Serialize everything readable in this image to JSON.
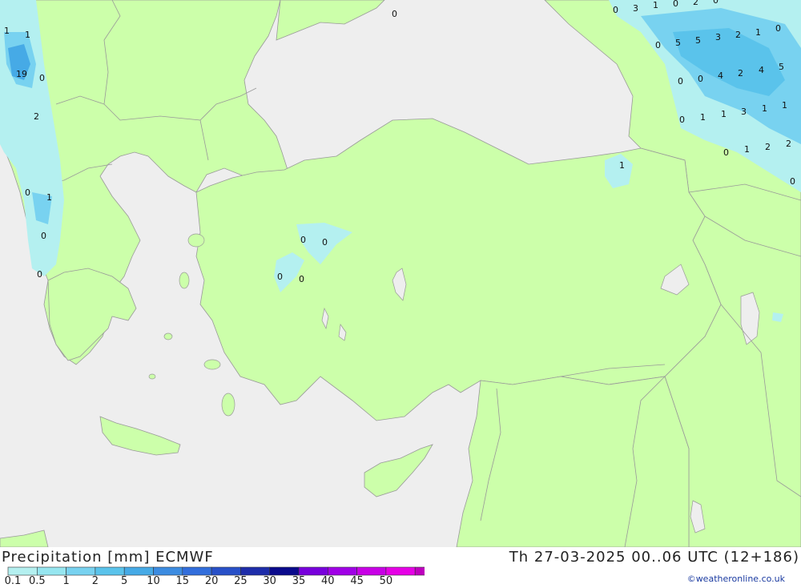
{
  "map": {
    "seas": "#eeeeee",
    "land": "#ccffaa",
    "border": "#999999",
    "city_mark": "0"
  },
  "footer": {
    "title": "Precipitation [mm] ECMWF",
    "datetime": "Th 27-03-2025 00..06 UTC (12+186)",
    "credit": "©weatheronline.co.uk"
  },
  "legend": {
    "ticks": [
      "0.1",
      "0.5",
      "1",
      "2",
      "5",
      "10",
      "15",
      "20",
      "25",
      "30",
      "35",
      "40",
      "45",
      "50"
    ],
    "colors": [
      "#b4f0f0",
      "#96e6f0",
      "#78d2f0",
      "#5ac3eb",
      "#46aae6",
      "#3c8ce1",
      "#326edc",
      "#2850c8",
      "#1e2daa",
      "#0a0a8c",
      "#7800dc",
      "#a000e6",
      "#c800e6",
      "#e600e6",
      "#be00be"
    ]
  },
  "precip_labels": [
    {
      "id": "a1",
      "text": "0"
    },
    {
      "id": "a2",
      "text": "3"
    },
    {
      "id": "a3",
      "text": "1"
    },
    {
      "id": "a4",
      "text": "0"
    },
    {
      "id": "a5",
      "text": "2"
    },
    {
      "id": "a6",
      "text": "0"
    },
    {
      "id": "b1",
      "text": "0"
    },
    {
      "id": "b2",
      "text": "5"
    },
    {
      "id": "b3",
      "text": "5"
    },
    {
      "id": "b4",
      "text": "3"
    },
    {
      "id": "b5",
      "text": "2"
    },
    {
      "id": "b6",
      "text": "1"
    },
    {
      "id": "b7",
      "text": "0"
    },
    {
      "id": "c1",
      "text": "0"
    },
    {
      "id": "c2",
      "text": "0"
    },
    {
      "id": "c3",
      "text": "4"
    },
    {
      "id": "c4",
      "text": "2"
    },
    {
      "id": "c5",
      "text": "4"
    },
    {
      "id": "c6",
      "text": "5"
    },
    {
      "id": "d1",
      "text": "0"
    },
    {
      "id": "d2",
      "text": "1"
    },
    {
      "id": "d3",
      "text": "1"
    },
    {
      "id": "d4",
      "text": "3"
    },
    {
      "id": "d5",
      "text": "1"
    },
    {
      "id": "d6",
      "text": "1"
    },
    {
      "id": "e1",
      "text": "0"
    },
    {
      "id": "e2",
      "text": "1"
    },
    {
      "id": "e3",
      "text": "2"
    },
    {
      "id": "e4",
      "text": "2"
    },
    {
      "id": "e5",
      "text": "0"
    },
    {
      "id": "f1",
      "text": "1"
    },
    {
      "id": "f2",
      "text": "1"
    },
    {
      "id": "f3",
      "text": "19"
    },
    {
      "id": "f4",
      "text": "0"
    },
    {
      "id": "f5",
      "text": "2"
    },
    {
      "id": "g1",
      "text": "0"
    },
    {
      "id": "g2",
      "text": "1"
    },
    {
      "id": "g3",
      "text": "0"
    },
    {
      "id": "g4",
      "text": "0"
    },
    {
      "id": "h1",
      "text": "0"
    },
    {
      "id": "h2",
      "text": "0"
    },
    {
      "id": "h3",
      "text": "0"
    },
    {
      "id": "h4",
      "text": "0"
    },
    {
      "id": "i1",
      "text": "1"
    },
    {
      "id": "j1",
      "text": "0"
    }
  ]
}
